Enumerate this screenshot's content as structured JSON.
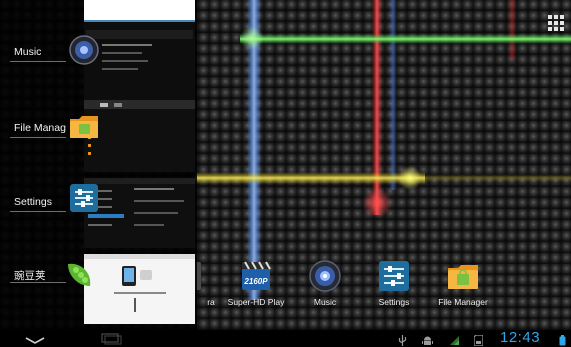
{
  "recent_apps": [
    {
      "label": "Music"
    },
    {
      "label": "File Manag"
    },
    {
      "label": "Settings"
    },
    {
      "label": "豌豆荚"
    }
  ],
  "dock": [
    {
      "label": "ra"
    },
    {
      "label": "Super-HD Play"
    },
    {
      "label": "Music"
    },
    {
      "label": "Settings"
    },
    {
      "label": "File Manager"
    }
  ],
  "status_bar": {
    "time": "12:43"
  },
  "icons": {
    "all_apps": "grid-icon",
    "back": "chevron-down-icon",
    "recent": "recent-apps-icon",
    "usb": "usb-icon",
    "debug": "android-debug-icon",
    "wifi": "wifi-icon",
    "sd": "sd-card-icon",
    "battery": "battery-icon"
  },
  "colors": {
    "clock": "#2fa6ea",
    "battery": "#2fa6ea",
    "beam_blue": "#6aa0ff",
    "beam_red": "#ff4a4a",
    "beam_green": "#7cff6a",
    "beam_yellow": "#ffee5a"
  }
}
